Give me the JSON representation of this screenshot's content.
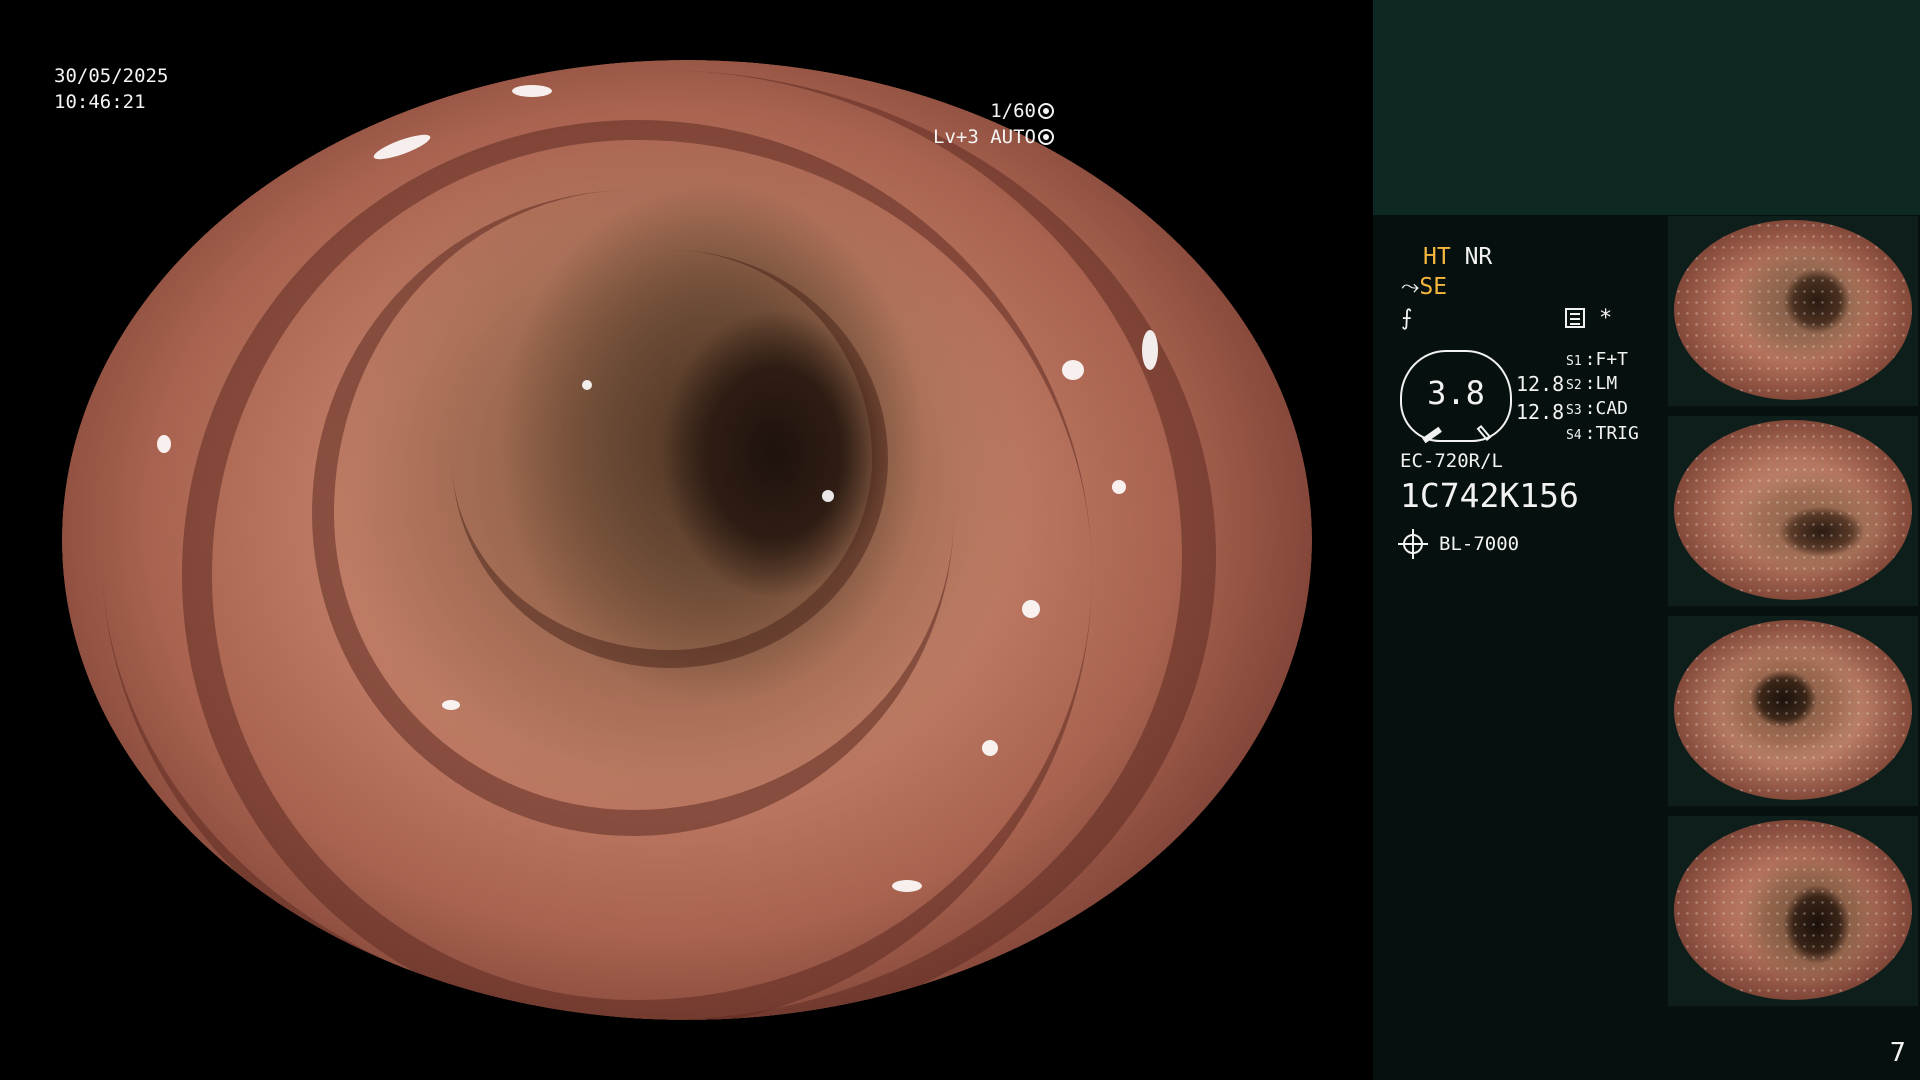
{
  "overlay": {
    "date": "30/05/2025",
    "time": "10:46:21",
    "shutter_speed": "1/60",
    "iris_level": "Lv+3 AUTO"
  },
  "panel": {
    "ht_label": "HT",
    "nr_label": "NR",
    "se_label": "SE",
    "star_label": "*",
    "zoom_value": "3.8",
    "value_1": "12.8",
    "value_2": "12.8",
    "switches": [
      {
        "key": "S1",
        "label": "F+T"
      },
      {
        "key": "S2",
        "label": "LM"
      },
      {
        "key": "S3",
        "label": "CAD"
      },
      {
        "key": "S4",
        "label": "TRIG"
      }
    ],
    "scope_model": "EC-720R/L",
    "scope_serial": "1C742K156",
    "light_source": "BL-7000",
    "page_number": "7"
  },
  "colors": {
    "panel_bg": "#06100e",
    "panel_top_bg": "#0e2824",
    "amber": "#f5b73e",
    "text": "#f2f2f2"
  },
  "icons": [
    "shutter-icon",
    "iris-icon",
    "structure-enhance-icon",
    "color-mode-icon",
    "settings-icon",
    "light-source-icon"
  ]
}
